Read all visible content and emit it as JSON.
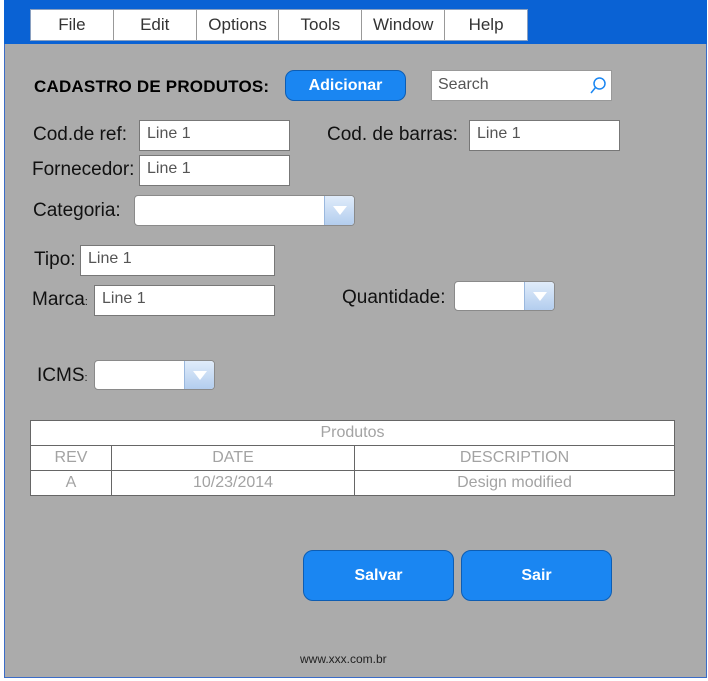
{
  "menu": [
    "File",
    "Edit",
    "Options",
    "Tools",
    "Window",
    "Help"
  ],
  "form": {
    "title": "CADASTRO DE PRODUTOS:",
    "add_button": "Adicionar",
    "search_placeholder": "Search",
    "cod_ref_label": "Cod.de ref:",
    "cod_ref_value": "Line 1",
    "cod_barras_label": "Cod. de barras:",
    "cod_barras_value": "Line 1",
    "fornecedor_label": "Fornecedor:",
    "fornecedor_value": "Line 1",
    "categoria_label": "Categoria:",
    "categoria_value": "",
    "tipo_label": "Tipo:",
    "tipo_value": "Line 1",
    "marca_label": "Marca:",
    "marca_value": "Line 1",
    "quantidade_label": "Quantidade:",
    "quantidade_value": "",
    "icms_label": "ICMS:",
    "icms_value": ""
  },
  "table": {
    "caption": "Produtos",
    "headers": [
      "REV",
      "DATE",
      "DESCRIPTION"
    ],
    "rows": [
      [
        "A",
        "10/23/2014",
        "Design modified"
      ]
    ]
  },
  "buttons": {
    "save": "Salvar",
    "exit": "Sair"
  },
  "footer": "www.xxx.com.br",
  "colors": {
    "topbar": "#0a62d4",
    "background": "#ababab",
    "accent": "#1a86f2"
  },
  "icons": {
    "search": "magnifier-icon",
    "dropdown": "chevron-down-icon"
  }
}
